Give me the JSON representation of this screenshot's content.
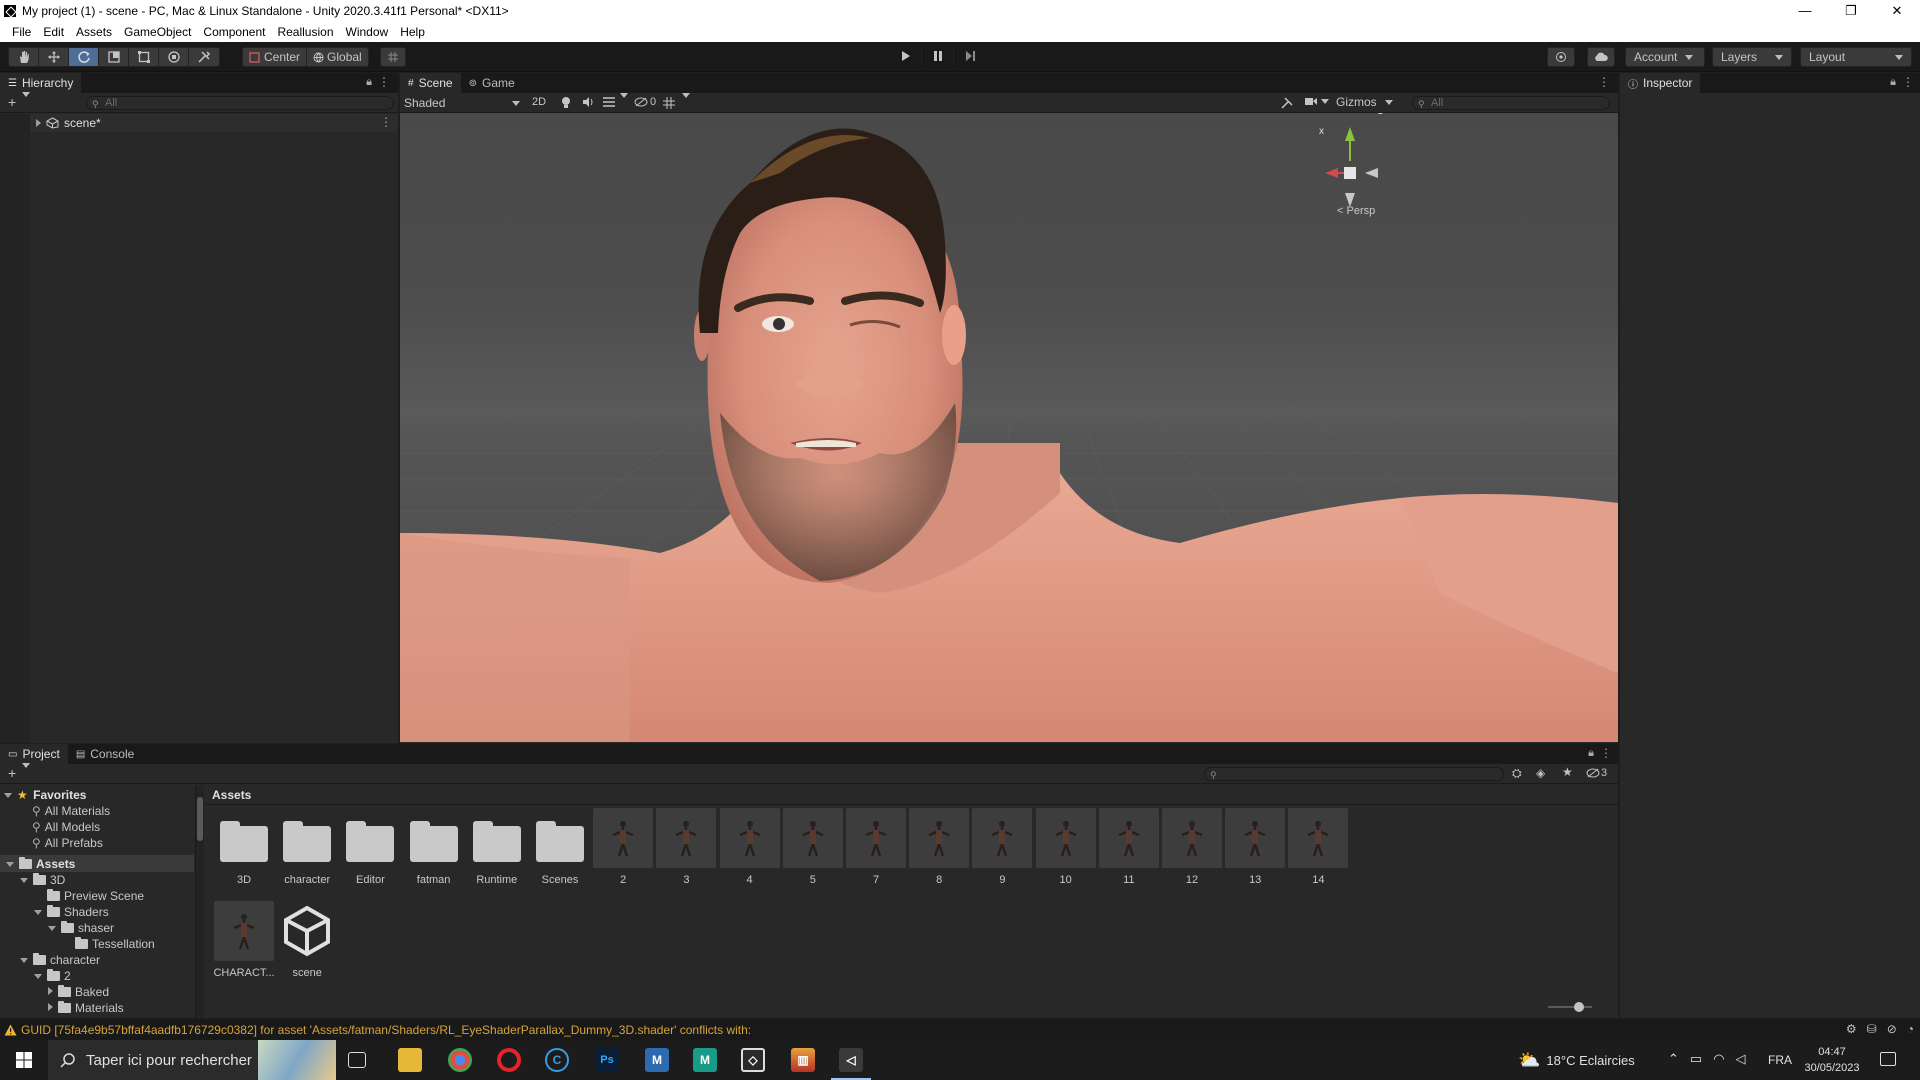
{
  "window": {
    "title": "My project (1) - scene - PC, Mac & Linux Standalone - Unity 2020.3.41f1 Personal* <DX11>",
    "minimize": "—",
    "restore": "❐",
    "close": "✕"
  },
  "menu": [
    "File",
    "Edit",
    "Assets",
    "GameObject",
    "Component",
    "Reallusion",
    "Window",
    "Help"
  ],
  "toolbar": {
    "pivot": "Center",
    "space": "Global",
    "account": "Account",
    "layers": "Layers",
    "layout": "Layout"
  },
  "hierarchy": {
    "tab": "Hierarchy",
    "search_placeholder": "All",
    "scene_name": "scene*"
  },
  "scene": {
    "tabs": [
      "Scene",
      "Game"
    ],
    "shading_mode": "Shaded",
    "mode_2d": "2D",
    "hidden_count": "0",
    "gizmos": "Gizmos",
    "search_placeholder": "All",
    "projection": "Persp",
    "axis_y": "y",
    "axis_x": "x"
  },
  "inspector": {
    "tab": "Inspector"
  },
  "project": {
    "tabs": [
      "Project",
      "Console"
    ],
    "hidden_count": "3",
    "favorites_label": "Favorites",
    "favorites": [
      "All Materials",
      "All Models",
      "All Prefabs"
    ],
    "tree": [
      {
        "label": "Assets",
        "depth": 0,
        "expanded": true,
        "bold": true
      },
      {
        "label": "3D",
        "depth": 1,
        "expanded": true
      },
      {
        "label": "Preview Scene",
        "depth": 2,
        "leaf": true
      },
      {
        "label": "Shaders",
        "depth": 2,
        "expanded": true
      },
      {
        "label": "shaser",
        "depth": 3,
        "expanded": true
      },
      {
        "label": "Tessellation",
        "depth": 4,
        "leaf": true
      },
      {
        "label": "character",
        "depth": 1,
        "expanded": true
      },
      {
        "label": "2",
        "depth": 2,
        "expanded": true
      },
      {
        "label": "Baked",
        "depth": 3,
        "expanded": false
      },
      {
        "label": "Materials",
        "depth": 3,
        "expanded": false
      }
    ],
    "breadcrumb": "Assets",
    "folders": [
      "3D",
      "character",
      "Editor",
      "fatman",
      "Runtime",
      "Scenes"
    ],
    "characters": [
      "2",
      "3",
      "4",
      "5",
      "7",
      "8",
      "9",
      "10",
      "11",
      "12",
      "13",
      "14"
    ],
    "row2": [
      {
        "label": "CHARACT...",
        "kind": "character"
      },
      {
        "label": "scene",
        "kind": "unity"
      }
    ]
  },
  "status": {
    "message": "GUID [75fa4e9b57bffaf4aadfb176729c0382] for asset 'Assets/fatman/Shaders/RL_EyeShaderParallax_Dummy_3D.shader' conflicts with:"
  },
  "taskbar": {
    "search_placeholder": "Taper ici pour rechercher",
    "weather": "18°C  Eclaircies",
    "language": "FRA",
    "time": "04:47",
    "date": "30/05/2023"
  },
  "colors": {
    "accent": "#4e6e98",
    "panel": "#282828",
    "warning": "#d6a33a"
  }
}
